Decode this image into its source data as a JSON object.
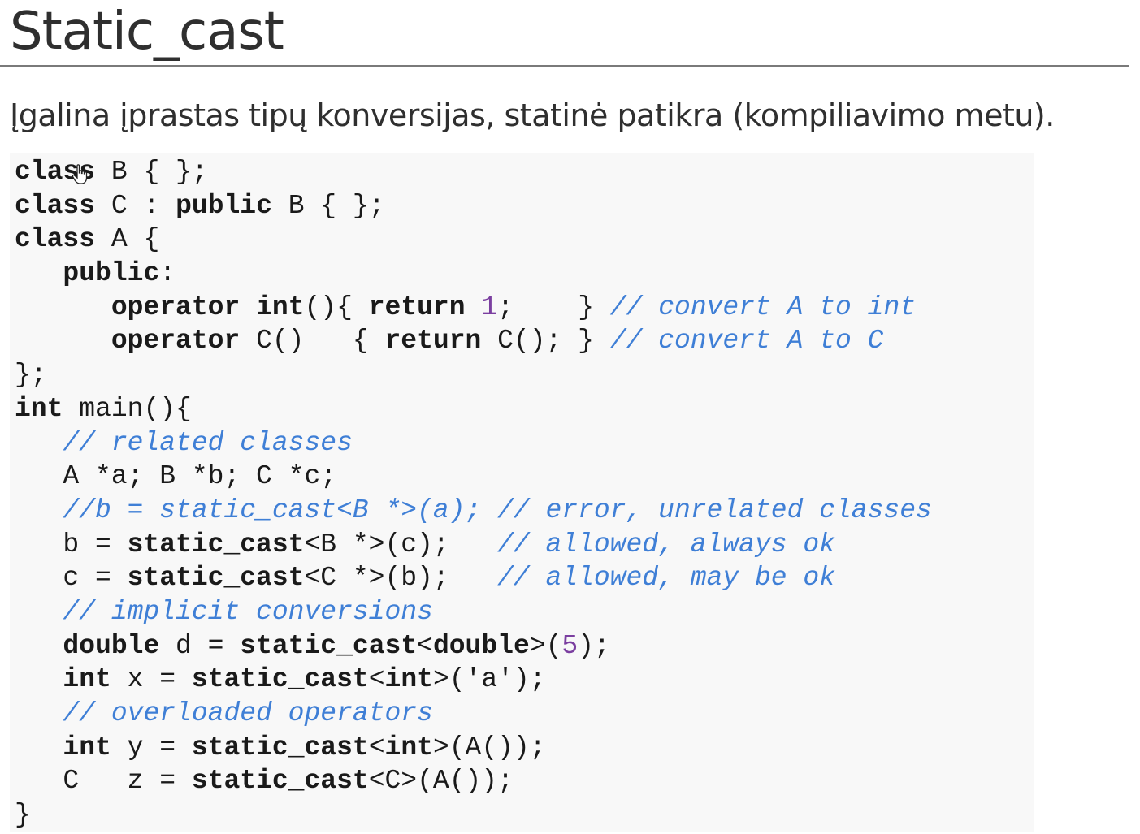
{
  "title": "Static_cast",
  "subtitle": "Įgalina įprastas tipų konversijas, statinė patikra (kompiliavimo metu).",
  "code_lines": [
    [
      {
        "t": "class",
        "k": "kw"
      },
      {
        "t": " B { };"
      }
    ],
    [
      {
        "t": "class",
        "k": "kw"
      },
      {
        "t": " C : "
      },
      {
        "t": "public",
        "k": "kw"
      },
      {
        "t": " B { };"
      }
    ],
    [
      {
        "t": "class",
        "k": "kw"
      },
      {
        "t": " A {"
      }
    ],
    [
      {
        "t": "   "
      },
      {
        "t": "public",
        "k": "kw"
      },
      {
        "t": ":"
      }
    ],
    [
      {
        "t": "      "
      },
      {
        "t": "operator",
        "k": "kw"
      },
      {
        "t": " "
      },
      {
        "t": "int",
        "k": "kw"
      },
      {
        "t": "(){ "
      },
      {
        "t": "return",
        "k": "kw"
      },
      {
        "t": " "
      },
      {
        "t": "1",
        "k": "num"
      },
      {
        "t": ";    } "
      },
      {
        "t": "// convert A to int",
        "k": "cm"
      }
    ],
    [
      {
        "t": "      "
      },
      {
        "t": "operator",
        "k": "kw"
      },
      {
        "t": " C()   { "
      },
      {
        "t": "return",
        "k": "kw"
      },
      {
        "t": " C(); } "
      },
      {
        "t": "// convert A to C",
        "k": "cm"
      }
    ],
    [
      {
        "t": "};"
      }
    ],
    [
      {
        "t": "int",
        "k": "kw"
      },
      {
        "t": " main(){"
      }
    ],
    [
      {
        "t": "   "
      },
      {
        "t": "// related classes",
        "k": "cm"
      }
    ],
    [
      {
        "t": "   A *a; B *b; C *c;"
      }
    ],
    [
      {
        "t": "   "
      },
      {
        "t": "//b = static_cast<B *>(a); // error, unrelated classes",
        "k": "cm"
      }
    ],
    [
      {
        "t": "   b = "
      },
      {
        "t": "static_cast",
        "k": "kw"
      },
      {
        "t": "<B *>(c);   "
      },
      {
        "t": "// allowed, always ok",
        "k": "cm"
      }
    ],
    [
      {
        "t": "   c = "
      },
      {
        "t": "static_cast",
        "k": "kw"
      },
      {
        "t": "<C *>(b);   "
      },
      {
        "t": "// allowed, may be ok",
        "k": "cm"
      }
    ],
    [
      {
        "t": "   "
      },
      {
        "t": "// implicit conversions",
        "k": "cm"
      }
    ],
    [
      {
        "t": "   "
      },
      {
        "t": "double",
        "k": "kw"
      },
      {
        "t": " d = "
      },
      {
        "t": "static_cast",
        "k": "kw"
      },
      {
        "t": "<"
      },
      {
        "t": "double",
        "k": "kw"
      },
      {
        "t": ">("
      },
      {
        "t": "5",
        "k": "num"
      },
      {
        "t": ");"
      }
    ],
    [
      {
        "t": "   "
      },
      {
        "t": "int",
        "k": "kw"
      },
      {
        "t": " x = "
      },
      {
        "t": "static_cast",
        "k": "kw"
      },
      {
        "t": "<"
      },
      {
        "t": "int",
        "k": "kw"
      },
      {
        "t": ">('a');"
      }
    ],
    [
      {
        "t": "   "
      },
      {
        "t": "// overloaded operators",
        "k": "cm"
      }
    ],
    [
      {
        "t": "   "
      },
      {
        "t": "int",
        "k": "kw"
      },
      {
        "t": " y = "
      },
      {
        "t": "static_cast",
        "k": "kw"
      },
      {
        "t": "<"
      },
      {
        "t": "int",
        "k": "kw"
      },
      {
        "t": ">(A());"
      }
    ],
    [
      {
        "t": "   C   z = "
      },
      {
        "t": "static_cast",
        "k": "kw"
      },
      {
        "t": "<C>(A());"
      }
    ],
    [
      {
        "t": "}"
      }
    ]
  ],
  "colors": {
    "comment": "#3f7fd6",
    "number": "#7b3fa0",
    "text": "#1a1a1a"
  },
  "cursor_icon": "hand-pointer-icon"
}
